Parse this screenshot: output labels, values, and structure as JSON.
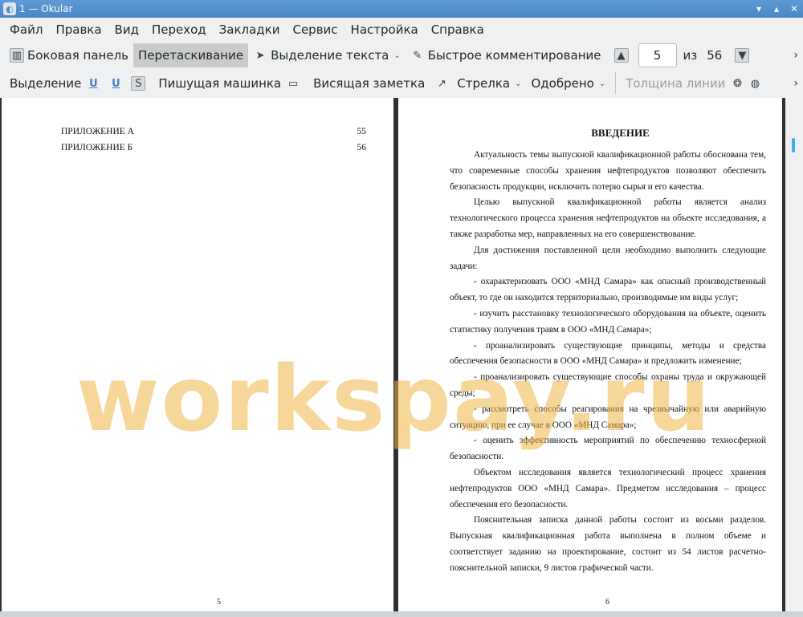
{
  "window": {
    "title": "1  — Okular"
  },
  "menu": [
    "Файл",
    "Правка",
    "Вид",
    "Переход",
    "Закладки",
    "Сервис",
    "Настройка",
    "Справка"
  ],
  "toolbar1": {
    "sidebar": "Боковая панель",
    "drag": "Перетаскивание",
    "text_select": "Выделение текста",
    "quick_comment": "Быстрое комментирование",
    "page_current": "5",
    "page_of": "из",
    "page_total": "56"
  },
  "toolbar2": {
    "selection": "Выделение",
    "typewriter": "Пишущая машинка",
    "hanging_note": "Висящая заметка",
    "arrow": "Стрелка",
    "approved": "Одобрено",
    "line_width": "Толщина линии"
  },
  "page_left": {
    "toc": [
      {
        "label": "ПРИЛОЖЕНИЕ А",
        "page": "55"
      },
      {
        "label": "ПРИЛОЖЕНИЕ Б",
        "page": "56"
      }
    ],
    "number": "5"
  },
  "page_right": {
    "heading": "ВВЕДЕНИЕ",
    "paragraphs": [
      "Актуальность темы выпускной квалификационной работы обоснована тем, что современные способы хранения нефтепродуктов позволяют обеспечить безопасность продукции, исключить потерю сырья и его качества.",
      "Целью выпускной квалификационной работы является анализ технологического процесса хранения нефтепродуктов на объекте исследования, а также разработка мер, направленных на его совершенствование.",
      "Для достижения поставленной цели необходимо выполнить следующие задачи:",
      "- охарактеризовать ООО «МНД Самара» как опасный производственный объект, то где он находится территориально, производимые им виды услуг;",
      "- изучить расстановку технологического оборудования на объекте, оценить статистику получения травм в ООО «МНД Самара»;",
      "- проанализировать существующие принципы, методы и средства обеспечения безопасности в ООО «МНД Самара» и предложить изменение;",
      "- проанализировать существующие способы охраны труда и окружающей среды;",
      "- рассмотреть способы реагирования на чрезвычайную или аварийную ситуацию, при ее случае в ООО «МНД Самара»;",
      "- оценить эффективность мероприятий по обеспечению техносферной безопасности.",
      "Объектом исследования является технологический процесс хранения нефтепродуктов ООО «МНД Самара». Предметом исследования – процесс обеспечения его безопасности.",
      "Пояснительная записка данной работы состоит из восьми разделов. Выпускная квалификационная работа выполнена в полном объеме и соответствует заданию на проектирование, состоит из 54 листов расчетно-пояснительной записки, 9 листов графической части."
    ],
    "number": "6"
  },
  "watermark": "workspay.ru"
}
